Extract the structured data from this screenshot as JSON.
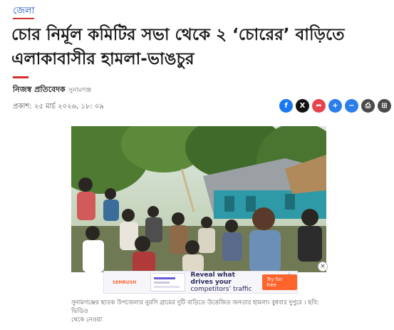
{
  "section": {
    "label": "জেলা"
  },
  "headline": {
    "line1": "চোর নির্মূল কমিটির সভা থেকে ২ ‘চোরের’ বাড়িতে",
    "line2": "এলাকাবাসীর হামলা-ভাঙচুর"
  },
  "author": {
    "name": "নিজস্ব প্রতিবেদক",
    "place": "সুনামগঞ্জ"
  },
  "published": "প্রকাশ: ২৫ মার্চ ২০২৬, ১৮: ০৯",
  "share": [
    {
      "icon": "facebook-icon",
      "glyph": "f",
      "color": "#1877f2"
    },
    {
      "icon": "x-icon",
      "glyph": "X",
      "color": "#111111"
    },
    {
      "icon": "share-arrow-icon",
      "glyph": "➦",
      "color": "#e8434a"
    },
    {
      "icon": "plus-share-icon",
      "glyph": "+",
      "color": "#2b7de9"
    },
    {
      "icon": "minus-share-icon",
      "glyph": "−",
      "color": "#2b7de9"
    },
    {
      "icon": "print-icon",
      "glyph": "⎙",
      "color": "#4a4a4a"
    },
    {
      "icon": "bookmark-icon",
      "glyph": "⊞",
      "color": "#4a4a4a"
    }
  ],
  "ad": {
    "brand": "SEMRUSH",
    "line1": "Reveal what drives your",
    "line2": "competitors’ traffic",
    "cta": "Try for free",
    "close": "×",
    "info": "i"
  },
  "caption": {
    "line1": "সুনামগঞ্জের ছাতক উপজেলার নুরসি গ্রামের দুটি বাড়িতে উত্তেজিত জনতার হামলা। বুধবার দুপুরে । ছবি: ভিডিও",
    "line2": "থেকে নেওয়া"
  },
  "colors": {
    "accent": "#d32f2f",
    "link": "#1a4fbf"
  }
}
